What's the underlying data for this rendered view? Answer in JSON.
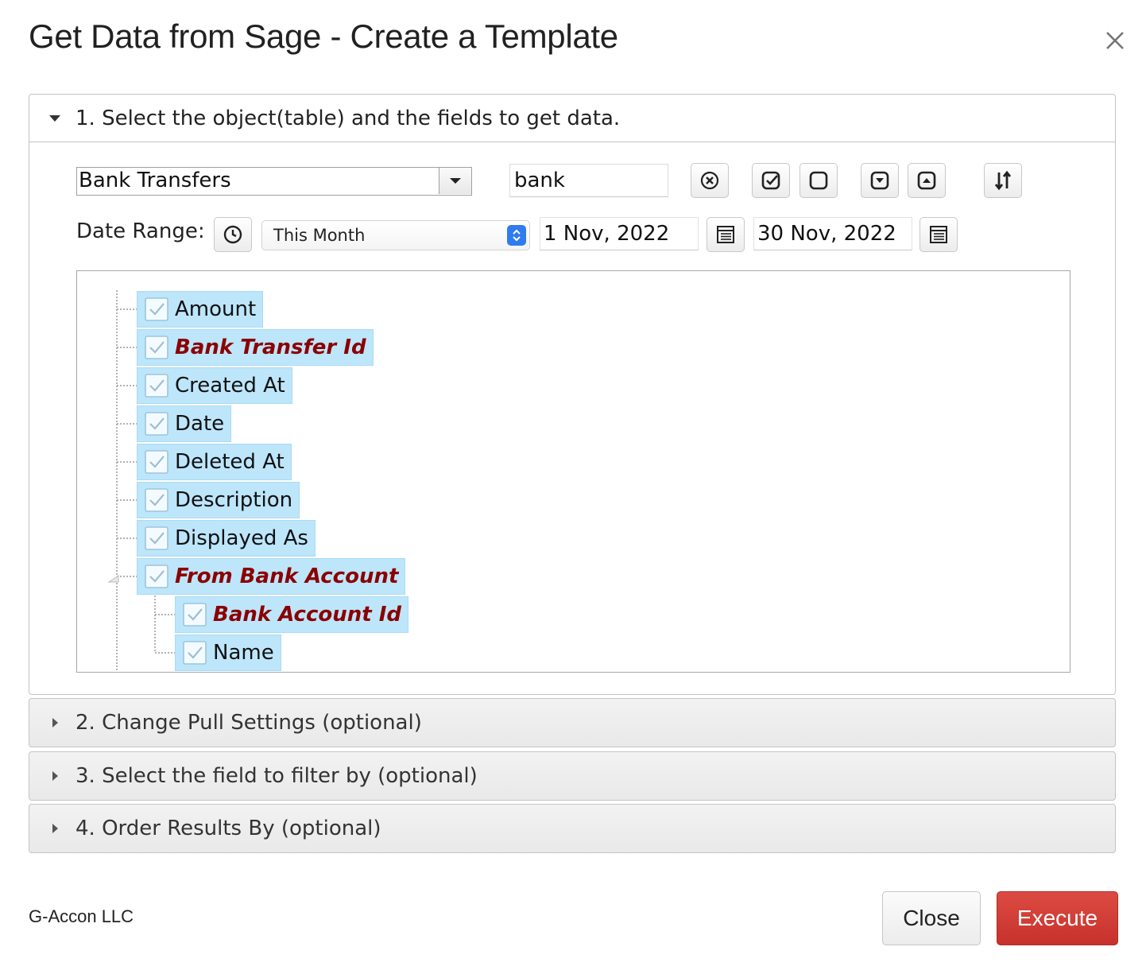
{
  "dialog": {
    "title": "Get Data from Sage - Create a Template"
  },
  "sections": [
    {
      "label": "1. Select the object(table) and the fields to get data.",
      "expanded": true
    },
    {
      "label": "2. Change Pull Settings (optional)",
      "expanded": false
    },
    {
      "label": "3. Select the field to filter by (optional)",
      "expanded": false
    },
    {
      "label": "4. Order Results By (optional)",
      "expanded": false
    }
  ],
  "object_select": {
    "value": "Bank Transfers"
  },
  "search": {
    "value": "bank"
  },
  "toolbar_icons": [
    "clear-search-icon",
    "check-all-icon",
    "uncheck-all-icon",
    "collapse-icon",
    "expand-icon",
    "sort-icon"
  ],
  "date_range": {
    "label": "Date Range:",
    "preset": "This Month",
    "start": "1 Nov, 2022",
    "end": "30 Nov, 2022"
  },
  "fields": [
    {
      "label": "Amount",
      "key": false,
      "checked": true,
      "level": 1
    },
    {
      "label": "Bank Transfer Id",
      "key": true,
      "checked": true,
      "level": 1
    },
    {
      "label": "Created At",
      "key": false,
      "checked": true,
      "level": 1
    },
    {
      "label": "Date",
      "key": false,
      "checked": true,
      "level": 1
    },
    {
      "label": "Deleted At",
      "key": false,
      "checked": true,
      "level": 1
    },
    {
      "label": "Description",
      "key": false,
      "checked": true,
      "level": 1
    },
    {
      "label": "Displayed As",
      "key": false,
      "checked": true,
      "level": 1
    },
    {
      "label": "From Bank Account",
      "key": true,
      "checked": true,
      "level": 1,
      "expanded": true
    },
    {
      "label": "Bank Account Id",
      "key": true,
      "checked": true,
      "level": 2
    },
    {
      "label": "Name",
      "key": false,
      "checked": true,
      "level": 2
    }
  ],
  "footer": {
    "brand": "G-Accon LLC",
    "close_label": "Close",
    "execute_label": "Execute"
  },
  "colors": {
    "key_field": "#8b0000",
    "selected_node": "#bde6fb",
    "execute_button": "#d03a33"
  }
}
